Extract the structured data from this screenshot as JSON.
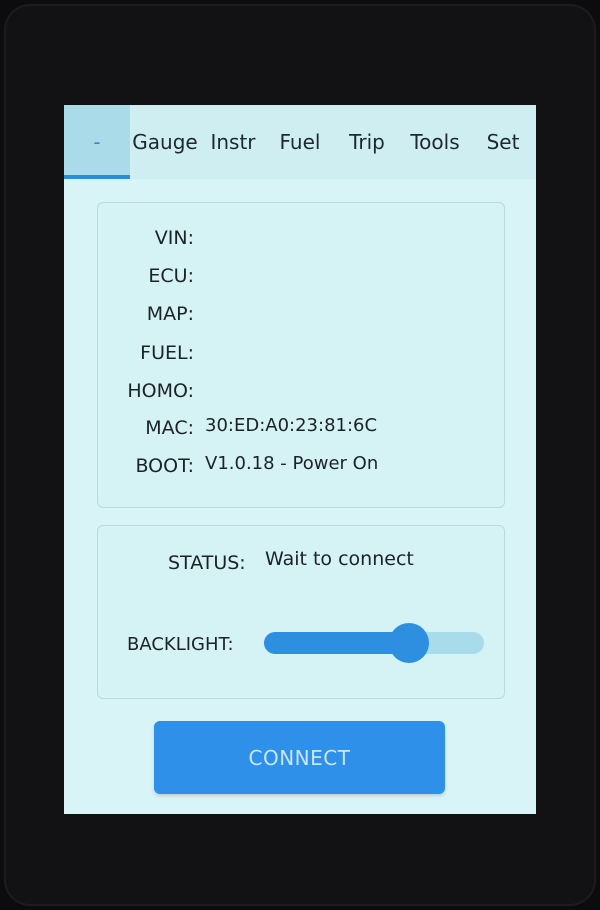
{
  "tabs": [
    {
      "label": "-",
      "active": true
    },
    {
      "label": "Gauge",
      "active": false
    },
    {
      "label": "Instr",
      "active": false
    },
    {
      "label": "Fuel",
      "active": false
    },
    {
      "label": "Trip",
      "active": false
    },
    {
      "label": "Tools",
      "active": false
    },
    {
      "label": "Set",
      "active": false
    }
  ],
  "info": [
    {
      "label": "VIN:",
      "value": ""
    },
    {
      "label": "ECU:",
      "value": ""
    },
    {
      "label": "MAP:",
      "value": ""
    },
    {
      "label": "FUEL:",
      "value": ""
    },
    {
      "label": "HOMO:",
      "value": ""
    },
    {
      "label": "MAC:",
      "value": "30:ED:A0:23:81:6C"
    },
    {
      "label": "BOOT:",
      "value": "V1.0.18 - Power On"
    }
  ],
  "status": {
    "label": "STATUS:",
    "value": "Wait to connect"
  },
  "backlight": {
    "label": "BACKLIGHT:",
    "level_percent": 66
  },
  "connect_button": {
    "label": "CONNECT"
  },
  "colors": {
    "accent": "#2e90e8",
    "screen_bg": "#d8f4f7",
    "track": "#a8dcea"
  }
}
